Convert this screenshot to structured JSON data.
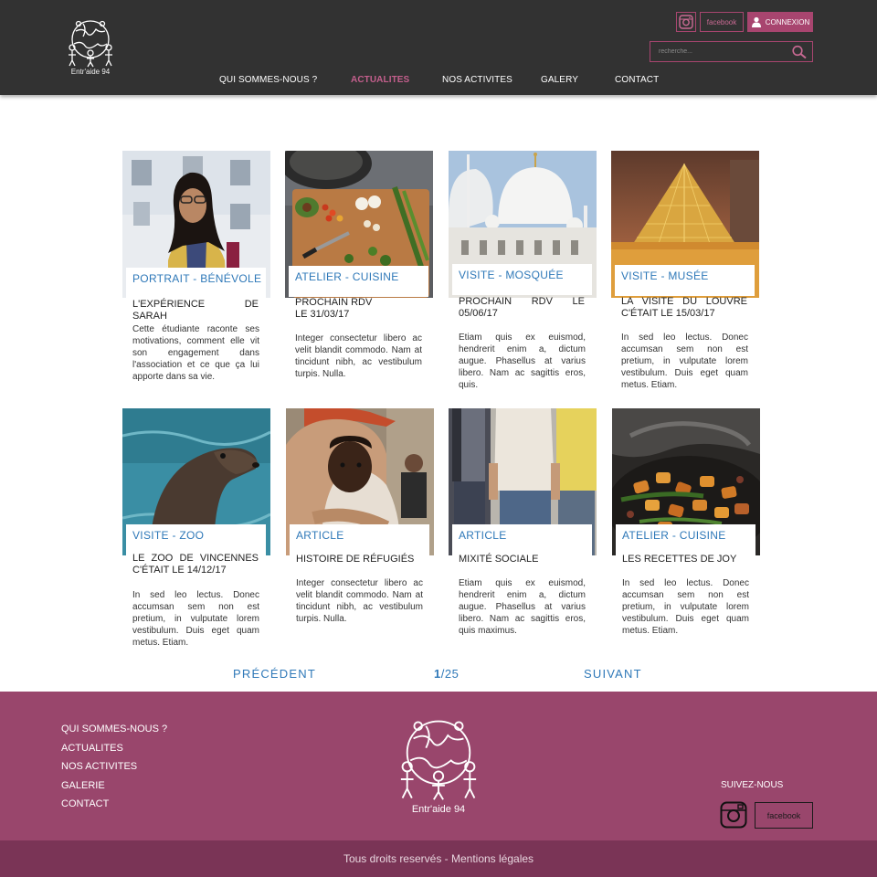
{
  "header": {
    "logo_text": "Entr'aide 94",
    "facebook_label": "facebook",
    "login_label": "CONNEXION",
    "search_placeholder": "recherche...",
    "nav": [
      {
        "label": "QUI SOMMES-NOUS ?",
        "active": false
      },
      {
        "label": "ACTUALITES",
        "active": true
      },
      {
        "label": "NOS ACTIVITES",
        "active": false
      },
      {
        "label": "GALERY",
        "active": false
      },
      {
        "label": "CONTACT",
        "active": false
      }
    ]
  },
  "cards": [
    {
      "tag": "PORTRAIT - BÉNÉVOLE",
      "title": "L'EXPÉRIENCE DE SARAH",
      "body": "Cette étudiante raconte ses motivations, comment elle vit son engagement dans l'association et ce que ça lui apporte dans sa vie.",
      "image": "portrait-photo"
    },
    {
      "tag": "ATELIER - CUISINE",
      "title": "PROCHAIN RDV\nLE 31/03/17",
      "body": "Integer consectetur libero ac velit blandit commodo. Nam at tincidunt nibh, ac vestibulum turpis. Nulla.",
      "image": "cooking-photo"
    },
    {
      "tag": "VISITE - MOSQUÉE",
      "title": "PROCHAIN RDV LE 05/06/17",
      "body": "Etiam quis ex euismod, hendrerit enim a, dictum augue. Phasellus at varius libero. Nam ac sagittis eros, quis.",
      "image": "mosque-photo"
    },
    {
      "tag": "VISITE - MUSÉE",
      "title": "LA VISITE DU LOUVRE C'ÉTAIT LE 15/03/17",
      "body": "In sed leo lectus. Donec accumsan sem non est pretium, in vulputate lorem vestibulum. Duis eget quam metus. Etiam.",
      "image": "louvre-photo"
    },
    {
      "tag": "VISITE - ZOO",
      "title": "LE ZOO DE VINCENNES C'ÉTAIT LE 14/12/17",
      "body": "In sed leo lectus. Donec accumsan sem non est pretium, in vulputate lorem vestibulum. Duis eget quam metus. Etiam.",
      "image": "sea-lion-photo"
    },
    {
      "tag": "ARTICLE",
      "title": "HISTOIRE DE RÉFUGIÉS",
      "body": "Integer consectetur libero ac velit blandit commodo. Nam at tincidunt nibh, ac vestibulum turpis. Nulla.",
      "image": "refugees-photo"
    },
    {
      "tag": "ARTICLE",
      "title": "MIXITÉ SOCIALE",
      "body": "Etiam quis ex euismod, hendrerit enim a, dictum augue. Phasellus at varius libero. Nam ac sagittis eros, quis maximus.",
      "image": "people-photo"
    },
    {
      "tag": "ATELIER - CUISINE",
      "title": "LES RECETTES DE JOY",
      "body": "In sed leo lectus. Donec accumsan sem non est pretium, in vulputate lorem vestibulum. Duis eget quam metus. Etiam.",
      "image": "food-photo"
    }
  ],
  "pagination": {
    "prev_label": "PRÉCÉDENT",
    "current_page": "1",
    "total_pages": "/25",
    "next_label": "SUIVANT"
  },
  "footer": {
    "links": [
      "QUI SOMMES-NOUS ?",
      "ACTUALITES",
      "NOS ACTIVITES",
      "GALERIE",
      "CONTACT"
    ],
    "logo_text": "Entr'aide 94",
    "follow_label": "SUIVEZ-NOUS",
    "facebook_label": "facebook",
    "copyright": "Tous droits reservés - Mentions légales"
  },
  "colors": {
    "header_bg": "#323232",
    "accent": "#a8456f",
    "footer_bg": "#99466c",
    "bottom_bar_bg": "#7a3456",
    "link_blue": "#2e78b8"
  }
}
